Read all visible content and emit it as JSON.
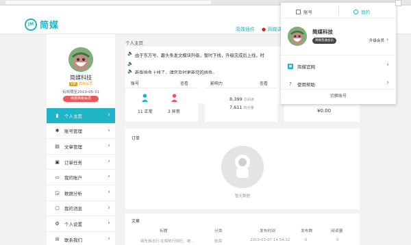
{
  "brand": {
    "name": "简媒",
    "mark": "JM",
    "accent": "#1fb4c6"
  },
  "topnav": {
    "plugin_link": "简媒插件",
    "extra_link": "简媒讲"
  },
  "sidebar": {
    "username": "简媒科技",
    "vip_badge": "VIP",
    "vip_text": "高级会员",
    "expiry": "有效期至2019-05-31",
    "renew_button": "续费高级会员",
    "items": [
      {
        "label": "个人主页",
        "icon": "user-icon"
      },
      {
        "label": "账号管理",
        "icon": "asterisk-icon"
      },
      {
        "label": "文章管理",
        "icon": "document-icon"
      },
      {
        "label": "订单任务",
        "icon": "task-icon"
      },
      {
        "label": "我的账户",
        "icon": "wallet-icon"
      },
      {
        "label": "数据分析",
        "icon": "chart-icon"
      },
      {
        "label": "我的消息",
        "icon": "message-icon"
      },
      {
        "label": "个人设置",
        "icon": "gear-icon"
      },
      {
        "label": "联系我们",
        "icon": "contact-icon"
      }
    ]
  },
  "main": {
    "breadcrumb": "个人主页",
    "notice": [
      "由于东方号、趣头条发文模块升级，暂时下线，升级完成后上线，时",
      "",
      "新版插件上线了，请您及时更新您的插件。"
    ],
    "account_card": {
      "title": "账号",
      "view": "查看",
      "normal_count": "11",
      "normal_label": "正常",
      "abnormal_count": "3",
      "abnormal_label": "异常"
    },
    "influence_card": {
      "title": "影响力",
      "view": "查看",
      "reads": "8,399",
      "reads_label": "总阅读",
      "fans": "7,611",
      "fans_label": "粉丝量"
    },
    "balance_card": {
      "amount": "¥0.00"
    },
    "orders": {
      "title": "订单",
      "empty_label": "暂无数据"
    },
    "articles": {
      "title": "文章",
      "columns": [
        "标题",
        "分类",
        "发布时间",
        "发布数",
        "阅读量"
      ],
      "row": [
        "骑车族出行·在相依行网行、被...",
        "航海",
        "2019-03-07 14:54:32",
        "0",
        "0"
      ]
    }
  },
  "dropdown": {
    "tab_account": "账号",
    "tab_mine": "我的",
    "name": "简媒科技",
    "badge": "简媒普通会员",
    "upgrade": "升级会员",
    "items": [
      "简媒官网",
      "使用帮助"
    ],
    "switch": "切换账号"
  }
}
